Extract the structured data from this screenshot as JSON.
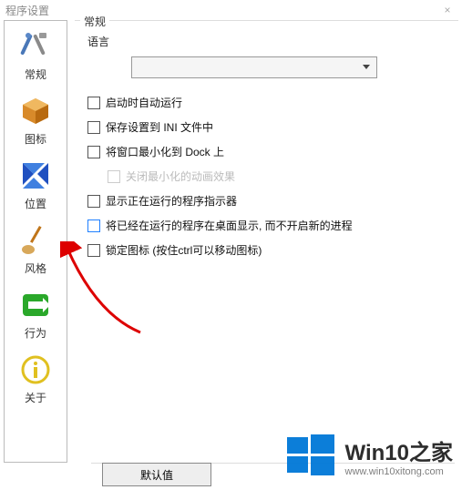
{
  "window": {
    "title": "程序设置",
    "close": "×"
  },
  "sidebar": {
    "items": [
      {
        "label": "常规",
        "icon": "tools-icon"
      },
      {
        "label": "图标",
        "icon": "box-icon"
      },
      {
        "label": "位置",
        "icon": "position-icon"
      },
      {
        "label": "风格",
        "icon": "brush-icon"
      },
      {
        "label": "行为",
        "icon": "action-icon"
      },
      {
        "label": "关于",
        "icon": "info-icon"
      }
    ]
  },
  "content": {
    "section_title": "常规",
    "language_label": "语言",
    "language_value": "",
    "checkboxes": {
      "autorun": "启动时自动运行",
      "save_ini": "保存设置到 INI 文件中",
      "min_dock": "将窗口最小化到 Dock 上",
      "close_anim": "关闭最小化的动画效果",
      "show_indicator": "显示正在运行的程序指示器",
      "show_running_desktop": "将已经在运行的程序在桌面显示, 而不开启新的进程",
      "lock_icons": "锁定图标 (按住ctrl可以移动图标)"
    }
  },
  "footer": {
    "default_button": "默认值"
  },
  "watermark": {
    "title": "Win10之家",
    "url": "www.win10xitong.com"
  }
}
